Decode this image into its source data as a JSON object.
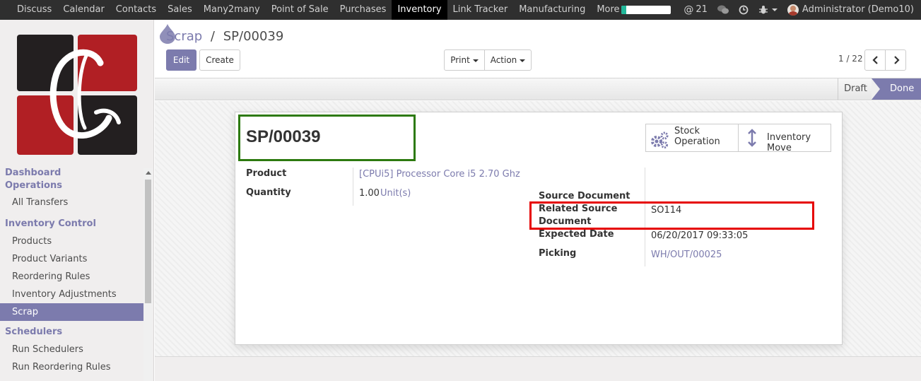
{
  "navbar": {
    "menu": [
      "Discuss",
      "Calendar",
      "Contacts",
      "Sales",
      "Many2many",
      "Point of Sale",
      "Purchases",
      "Inventory",
      "Link Tracker",
      "Manufacturing",
      "More"
    ],
    "active": "Inventory",
    "progress_fraction": 0.1,
    "mentions_count": "21",
    "user": "Administrator (Demo10)"
  },
  "sidebar": {
    "sections": [
      {
        "title": "Dashboard Operations",
        "items": [
          "All Transfers"
        ]
      },
      {
        "title": "Inventory Control",
        "items": [
          "Products",
          "Product Variants",
          "Reordering Rules",
          "Inventory Adjustments",
          "Scrap"
        ]
      },
      {
        "title": "Schedulers",
        "items": [
          "Run Schedulers",
          "Run Reordering Rules"
        ]
      }
    ],
    "active_item": "Scrap"
  },
  "breadcrumb": {
    "parent": "Scrap",
    "separator": "/",
    "current": "SP/00039"
  },
  "buttons": {
    "edit": "Edit",
    "create": "Create",
    "print": "Print",
    "action": "Action"
  },
  "pager": {
    "value": "1 / 22"
  },
  "statusbar": {
    "stages": [
      "Draft",
      "Done"
    ],
    "current": "Done"
  },
  "form": {
    "title": "SP/00039",
    "smart_buttons": [
      {
        "label_line1": "Stock",
        "label_line2": "Operation",
        "icon": "gears-icon"
      },
      {
        "label": "Inventory Move",
        "icon": "arrows-v-icon"
      }
    ],
    "left": {
      "product_label": "Product",
      "product_value": "[CPUi5] Processor Core i5 2.70 Ghz",
      "quantity_label": "Quantity",
      "quantity_value": "1.00",
      "quantity_uom": "Unit(s)"
    },
    "right": {
      "source_document_label": "Source Document",
      "related_source_label_1": "Related Source",
      "related_source_label_2": "Document",
      "related_source_value": "SO114",
      "expected_date_label": "Expected Date",
      "expected_date_value": "06/20/2017 09:33:05",
      "picking_label": "Picking",
      "picking_value": "WH/OUT/00025"
    }
  },
  "colors": {
    "brand": "#7c7bad",
    "navbar": "#2f2f2f",
    "highlight_green": "#2d7a10",
    "highlight_red": "#e60000"
  }
}
